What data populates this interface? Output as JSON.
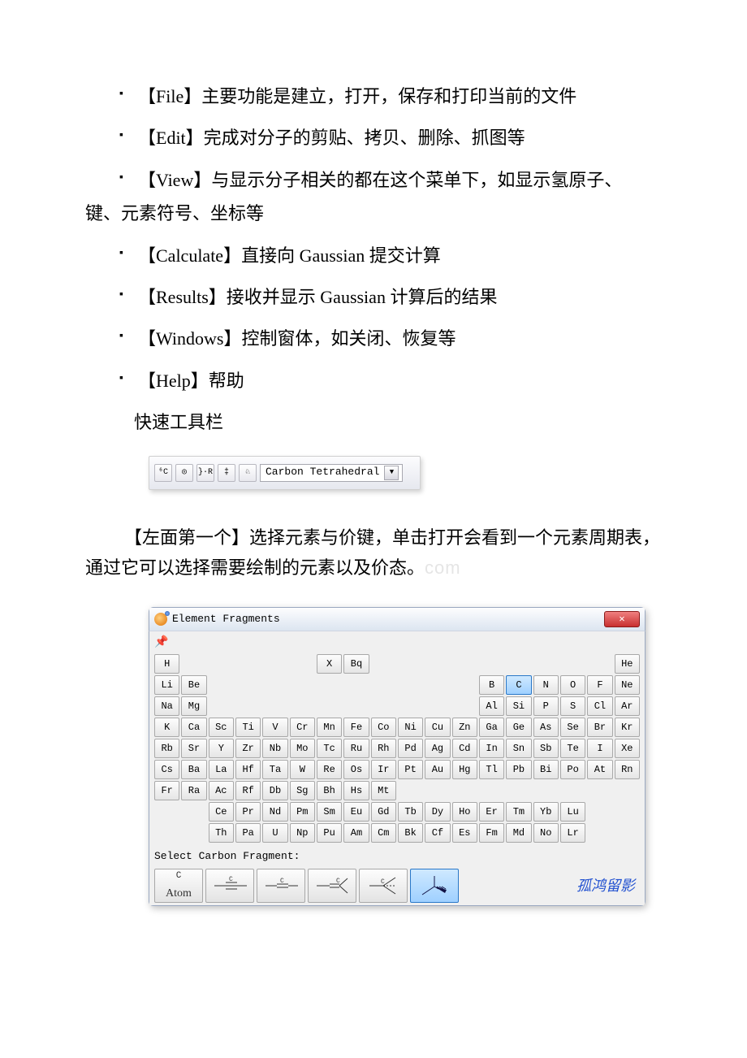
{
  "menu_items": [
    "【File】主要功能是建立，打开，保存和打印当前的文件",
    "【Edit】完成对分子的剪贴、拷贝、删除、抓图等",
    "【View】与显示分子相关的都在这个菜单下，如显示氢原子、",
    "【Calculate】直接向 Gaussian 提交计算",
    "【Results】接收并显示 Gaussian 计算后的结果",
    "【Windows】控制窗体，如关闭、恢复等",
    "【Help】帮助"
  ],
  "view_continuation": "键、元素符号、坐标等",
  "heading_quickbar": "快速工具栏",
  "toolbar": {
    "btns": [
      "⁶C",
      "◎",
      "}·R",
      "‡",
      "♘"
    ],
    "dropdown": "Carbon Tetrahedral"
  },
  "paragraph": "【左面第一个】选择元素与价键，单击打开会看到一个元素周期表，通过它可以选择需要绘制的元素以及价态。",
  "watermark_suffix": "com",
  "dialog": {
    "title": "Element Fragments",
    "close": "✕",
    "pin": "📌",
    "periodic_rows": [
      [
        "H",
        "",
        "",
        "",
        "",
        "",
        "X",
        "Bq",
        "",
        "",
        "",
        "",
        "",
        "",
        "",
        "",
        "",
        "He"
      ],
      [
        "Li",
        "Be",
        "",
        "",
        "",
        "",
        "",
        "",
        "",
        "",
        "",
        "",
        "B",
        "C",
        "N",
        "O",
        "F",
        "Ne"
      ],
      [
        "Na",
        "Mg",
        "",
        "",
        "",
        "",
        "",
        "",
        "",
        "",
        "",
        "",
        "Al",
        "Si",
        "P",
        "S",
        "Cl",
        "Ar"
      ],
      [
        "K",
        "Ca",
        "Sc",
        "Ti",
        "V",
        "Cr",
        "Mn",
        "Fe",
        "Co",
        "Ni",
        "Cu",
        "Zn",
        "Ga",
        "Ge",
        "As",
        "Se",
        "Br",
        "Kr"
      ],
      [
        "Rb",
        "Sr",
        "Y",
        "Zr",
        "Nb",
        "Mo",
        "Tc",
        "Ru",
        "Rh",
        "Pd",
        "Ag",
        "Cd",
        "In",
        "Sn",
        "Sb",
        "Te",
        "I",
        "Xe"
      ],
      [
        "Cs",
        "Ba",
        "La",
        "Hf",
        "Ta",
        "W",
        "Re",
        "Os",
        "Ir",
        "Pt",
        "Au",
        "Hg",
        "Tl",
        "Pb",
        "Bi",
        "Po",
        "At",
        "Rn"
      ],
      [
        "Fr",
        "Ra",
        "Ac",
        "Rf",
        "Db",
        "Sg",
        "Bh",
        "Hs",
        "Mt",
        "",
        "",
        "",
        "",
        "",
        "",
        "",
        "",
        ""
      ],
      [
        "",
        "",
        "Ce",
        "Pr",
        "Nd",
        "Pm",
        "Sm",
        "Eu",
        "Gd",
        "Tb",
        "Dy",
        "Ho",
        "Er",
        "Tm",
        "Yb",
        "Lu",
        "",
        ""
      ],
      [
        "",
        "",
        "Th",
        "Pa",
        "U",
        "Np",
        "Pu",
        "Am",
        "Cm",
        "Bk",
        "Cf",
        "Es",
        "Fm",
        "Md",
        "No",
        "Lr",
        "",
        ""
      ]
    ],
    "selected_element": "C",
    "select_label": "Select Carbon Fragment:",
    "fragments": {
      "atom_c": "C",
      "atom_label": "Atom"
    },
    "signature": "孤鸿留影"
  }
}
